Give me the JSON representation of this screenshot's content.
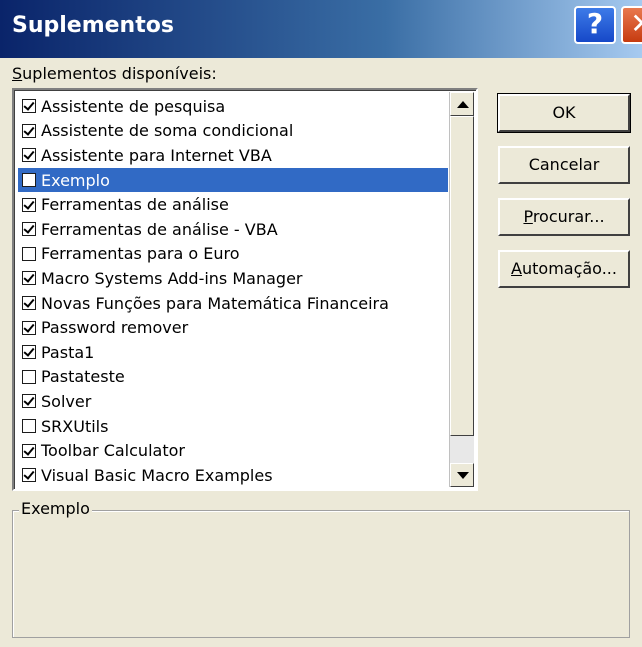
{
  "dialog": {
    "title": "Suplementos",
    "help_glyph": "?",
    "close_glyph": "✕"
  },
  "list_label_accel": "S",
  "list_label_rest": "uplementos disponíveis:",
  "addins": [
    {
      "label": "Assistente de pesquisa",
      "checked": true,
      "selected": false
    },
    {
      "label": "Assistente de soma condicional",
      "checked": true,
      "selected": false
    },
    {
      "label": "Assistente para Internet VBA",
      "checked": true,
      "selected": false
    },
    {
      "label": "Exemplo",
      "checked": false,
      "selected": true
    },
    {
      "label": "Ferramentas de análise",
      "checked": true,
      "selected": false
    },
    {
      "label": "Ferramentas de análise - VBA",
      "checked": true,
      "selected": false
    },
    {
      "label": "Ferramentas para o Euro",
      "checked": false,
      "selected": false
    },
    {
      "label": "Macro Systems Add-ins Manager",
      "checked": true,
      "selected": false
    },
    {
      "label": "Novas Funções para Matemática Financeira",
      "checked": true,
      "selected": false
    },
    {
      "label": "Password remover",
      "checked": true,
      "selected": false
    },
    {
      "label": "Pasta1",
      "checked": true,
      "selected": false
    },
    {
      "label": "Pastateste",
      "checked": false,
      "selected": false
    },
    {
      "label": "Solver",
      "checked": true,
      "selected": false
    },
    {
      "label": "SRXUtils",
      "checked": false,
      "selected": false
    },
    {
      "label": "Toolbar Calculator",
      "checked": true,
      "selected": false
    },
    {
      "label": "Visual Basic Macro Examples",
      "checked": true,
      "selected": false
    }
  ],
  "buttons": {
    "ok": "OK",
    "cancel": "Cancelar",
    "browse_accel": "P",
    "browse_rest": "rocurar...",
    "automation_accel": "A",
    "automation_rest": "utomação..."
  },
  "description": {
    "legend": "Exemplo",
    "text": ""
  },
  "colors": {
    "selection": "#316ac5",
    "title_gradient_start": "#0a246a",
    "dialog_face": "#ece9d8"
  }
}
